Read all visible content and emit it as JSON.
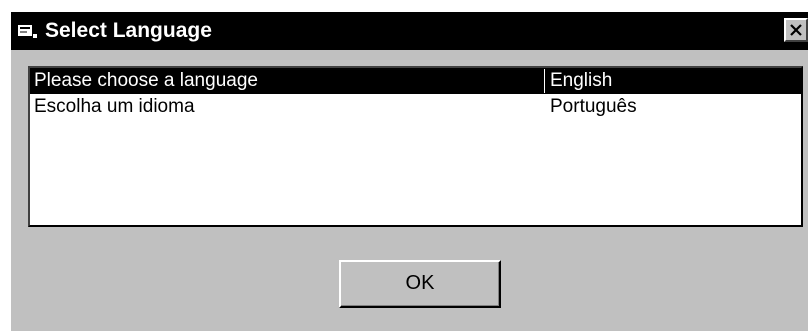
{
  "window": {
    "title": "Select Language"
  },
  "list": {
    "rows": [
      {
        "text": "Please choose a language",
        "language": "English",
        "selected": true
      },
      {
        "text": "Escolha um idioma",
        "language": "Português",
        "selected": false
      }
    ]
  },
  "buttons": {
    "ok_label": "OK"
  },
  "icons": {
    "app": "app-window-icon",
    "close": "close-icon"
  },
  "colors": {
    "title_bar": "#000000",
    "dialog_face": "#c0c0c0",
    "selection": "#000000"
  }
}
